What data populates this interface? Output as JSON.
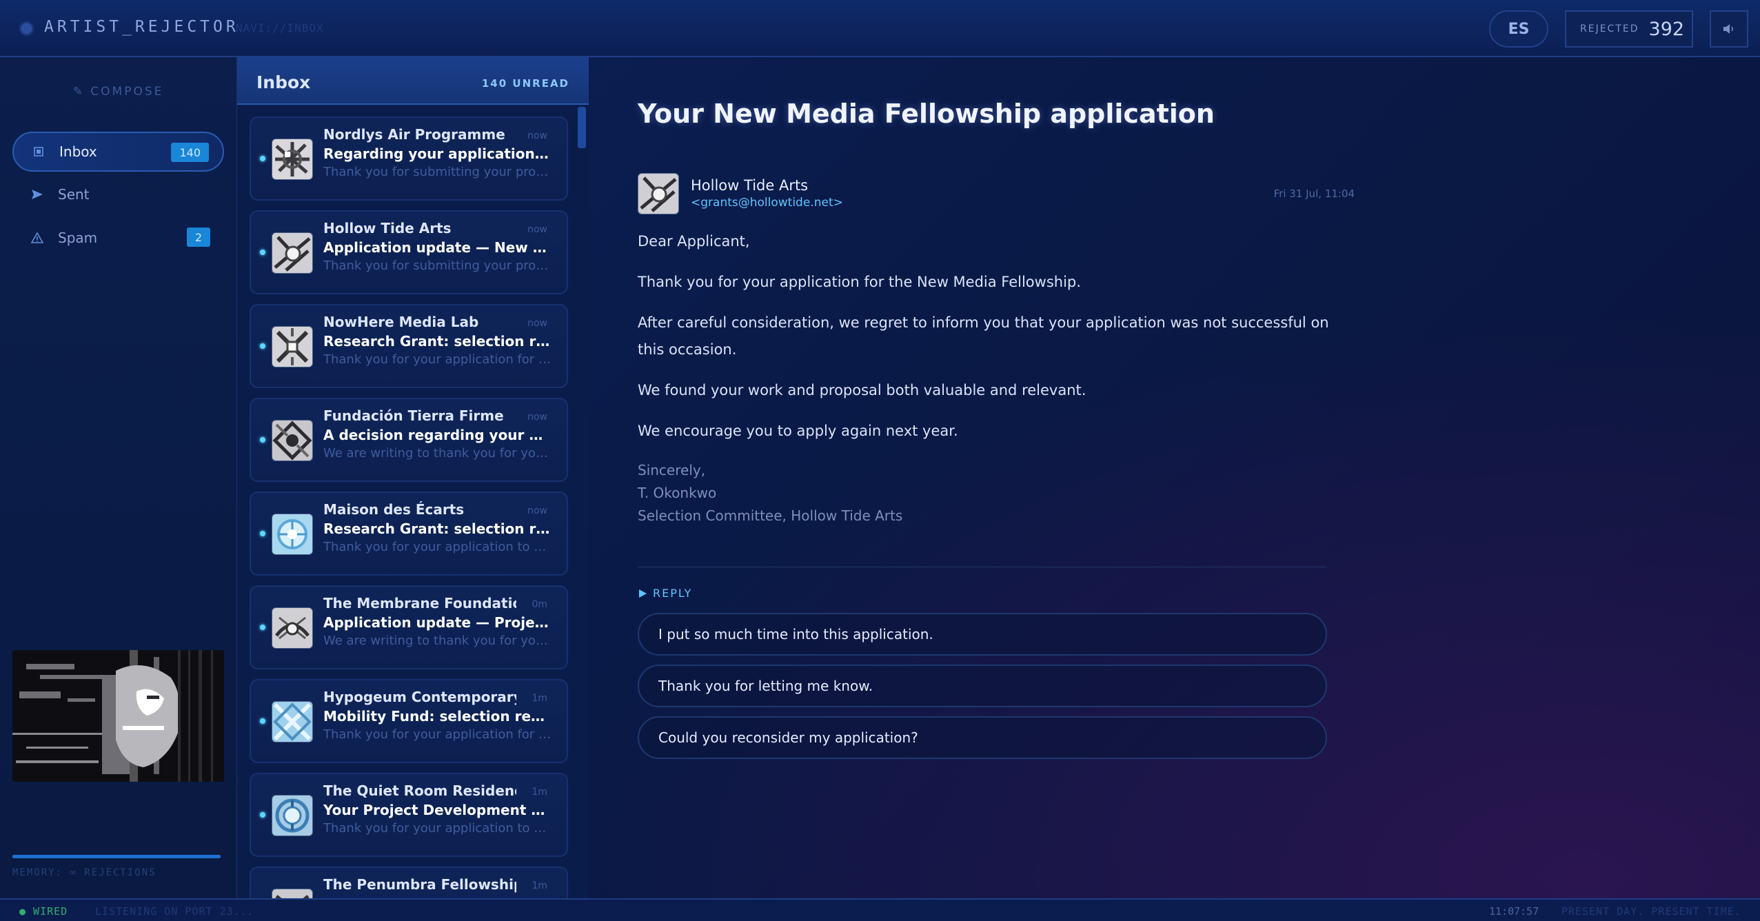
{
  "app": {
    "title": "ARTIST_REJECTOR",
    "nav_path": "NAVI://INBOX",
    "language_button": "ES",
    "rejected_label": "REJECTED",
    "rejected_count": "392"
  },
  "sidebar": {
    "compose_label": "COMPOSE",
    "items": [
      {
        "label": "Inbox",
        "badge": "140",
        "icon": "inbox-icon"
      },
      {
        "label": "Sent",
        "icon": "send-icon"
      },
      {
        "label": "Spam",
        "badge": "2",
        "icon": "warning-icon"
      }
    ],
    "memory_label": "MEMORY: ∞ REJECTIONS"
  },
  "inbox": {
    "title": "Inbox",
    "unread_label": "140 UNREAD",
    "mails": [
      {
        "from": "Nordlys Air Programme",
        "time": "now",
        "subject": "Regarding your application to N...",
        "preview": "Thank you for submitting your prop..."
      },
      {
        "from": "Hollow Tide Arts",
        "time": "now",
        "subject": "Application update — New Medi...",
        "preview": "Thank you for submitting your prop..."
      },
      {
        "from": "NowHere Media Lab",
        "time": "now",
        "subject": "Research Grant: selection results",
        "preview": "Thank you for your application for t..."
      },
      {
        "from": "Fundación Tierra Firme",
        "time": "now",
        "subject": "A decision regarding your submi...",
        "preview": "We are writing to thank you for your..."
      },
      {
        "from": "Maison des Écarts",
        "time": "now",
        "subject": "Research Grant: selection results",
        "preview": "Thank you for your application to th..."
      },
      {
        "from": "The Membrane Foundation",
        "time": "0m",
        "subject": "Application update — Project De...",
        "preview": "We are writing to thank you for your..."
      },
      {
        "from": "Hypogeum Contemporary",
        "time": "1m",
        "subject": "Mobility Fund: selection results",
        "preview": "Thank you for your application for t..."
      },
      {
        "from": "The Quiet Room Residency",
        "time": "1m",
        "subject": "Your Project Development Fund ...",
        "preview": "Thank you for your application to th..."
      },
      {
        "from": "The Penumbra Fellowship",
        "time": "1m",
        "subject": "",
        "preview": ""
      }
    ]
  },
  "reader": {
    "subject": "Your New Media Fellowship application",
    "sender_name": "Hollow Tide Arts",
    "sender_email": "<grants@hollowtide.net>",
    "date": "Fri 31 Jul, 11:04",
    "body": [
      "Dear Applicant,",
      "Thank you for your application for the New Media Fellowship.",
      "After careful consideration, we regret to inform you that your application was not successful on this occasion.",
      "We found your work and proposal both valuable and relevant.",
      "We encourage you to apply again next year."
    ],
    "signature": [
      "Sincerely,",
      "T. Okonkwo",
      "Selection Committee, Hollow Tide Arts"
    ],
    "reply_label": "REPLY",
    "reply_options": [
      "I put so much time into this application.",
      "Thank you for letting me know.",
      "Could you reconsider my application?"
    ]
  },
  "status": {
    "wired": "● WIRED",
    "listening": "LISTENING ON PORT 23...",
    "clock": "11:07:57",
    "present": "PRESENT DAY. PRESENT TIME."
  },
  "colors": {
    "accent": "#5fc4ff",
    "badge": "#1a86d8",
    "wired": "#2fb070",
    "background": "#0a1a48"
  }
}
